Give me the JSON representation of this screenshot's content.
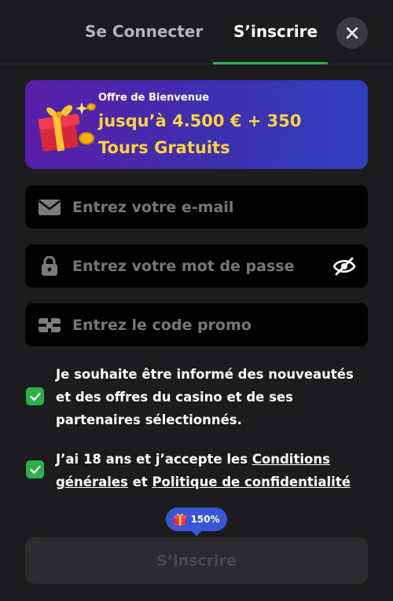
{
  "tabs": {
    "login": "Se Connecter",
    "signup": "S’inscrire",
    "active_color": "#2bb04a"
  },
  "close_icon": "close-icon",
  "promo": {
    "eyebrow": "Offre de Bienvenue",
    "line1": "jusqu’à 4.500 € + 350",
    "line2": "Tours Gratuits",
    "icon": "gift-icon",
    "highlight_color": "#ffd43a"
  },
  "fields": {
    "email": {
      "placeholder": "Entrez votre e-mail",
      "value": "",
      "icon": "envelope-icon"
    },
    "password": {
      "placeholder": "Entrez votre mot de passe",
      "value": "",
      "icon": "lock-icon",
      "toggle_icon": "eye-off-icon"
    },
    "promo_code": {
      "placeholder": "Entrez le code promo",
      "value": "",
      "icon": "promo-code-icon"
    }
  },
  "consents": {
    "newsletter": {
      "checked": true,
      "text": "Je souhaite être informé des nouveautés et des offres du casino et de ses partenaires sélectionnés."
    },
    "terms": {
      "checked": true,
      "prefix": "J’ai 18 ans et j’accepte les ",
      "conditions_link": "Conditions générales",
      "middle": " et ",
      "privacy_link": "Politique de confidentialité"
    }
  },
  "bonus_badge": {
    "label": "150%",
    "icon": "gift-icon"
  },
  "submit": {
    "label": "S’inscrire",
    "enabled": false
  }
}
